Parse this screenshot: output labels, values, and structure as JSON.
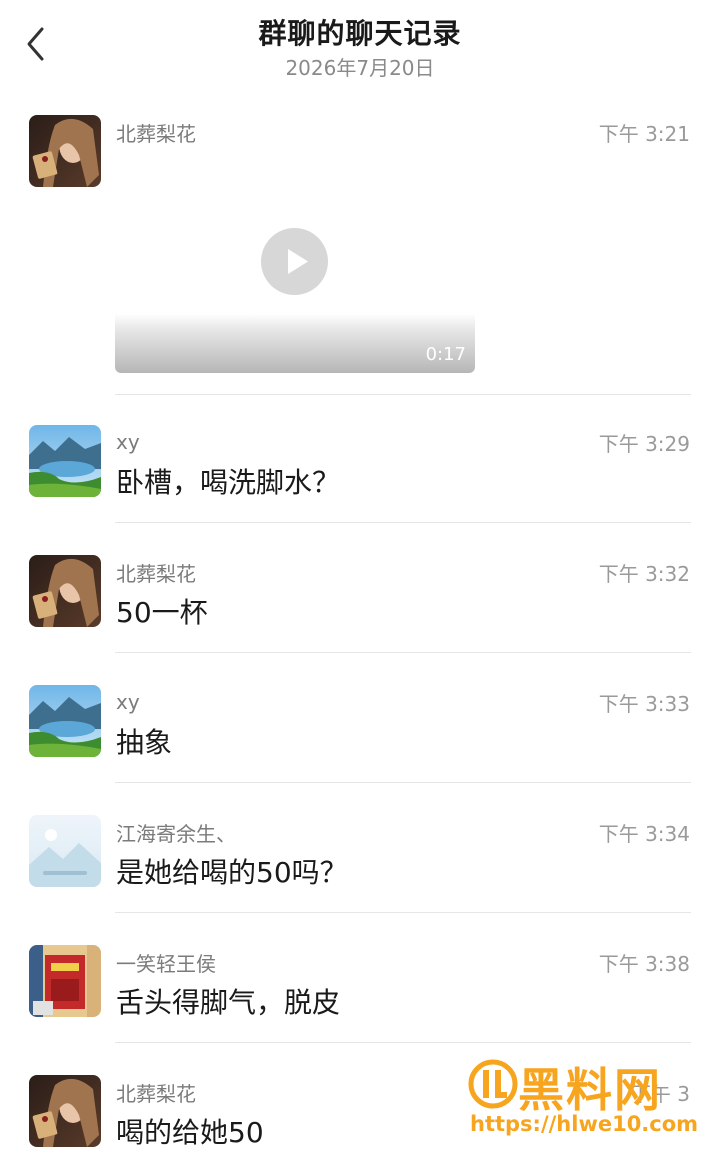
{
  "header": {
    "title": "群聊的聊天记录",
    "date": "2026年7月20日",
    "back_icon": "chevron-left-icon"
  },
  "messages": [
    {
      "sender": "北葬梨花",
      "time": "下午 3:21",
      "type": "video",
      "video_duration": "0:17",
      "avatar": "woman-portrait"
    },
    {
      "sender": "xy",
      "time": "下午 3:29",
      "text": "卧槽，喝洗脚水？",
      "avatar": "lake-landscape"
    },
    {
      "sender": "北葬梨花",
      "time": "下午 3:32",
      "text": "50一杯",
      "avatar": "woman-portrait"
    },
    {
      "sender": "xy",
      "time": "下午 3:33",
      "text": "抽象",
      "avatar": "lake-landscape"
    },
    {
      "sender": "江海寄余生、",
      "time": "下午 3:34",
      "text": "是她给喝的50吗？",
      "avatar": "pale-placeholder"
    },
    {
      "sender": "一笑轻王侯",
      "time": "下午 3:38",
      "text": "舌头得脚气，脱皮",
      "avatar": "red-poster"
    },
    {
      "sender": "北葬梨花",
      "time": "下午 3",
      "text": "喝的给她50",
      "avatar": "woman-portrait"
    }
  ],
  "watermark": {
    "brand": "黑料网",
    "url": "https://hlwe10.com",
    "color": "#f7a51e"
  },
  "colors": {
    "divider": "#e6e6e6",
    "meta_text": "#8a8a8a"
  }
}
